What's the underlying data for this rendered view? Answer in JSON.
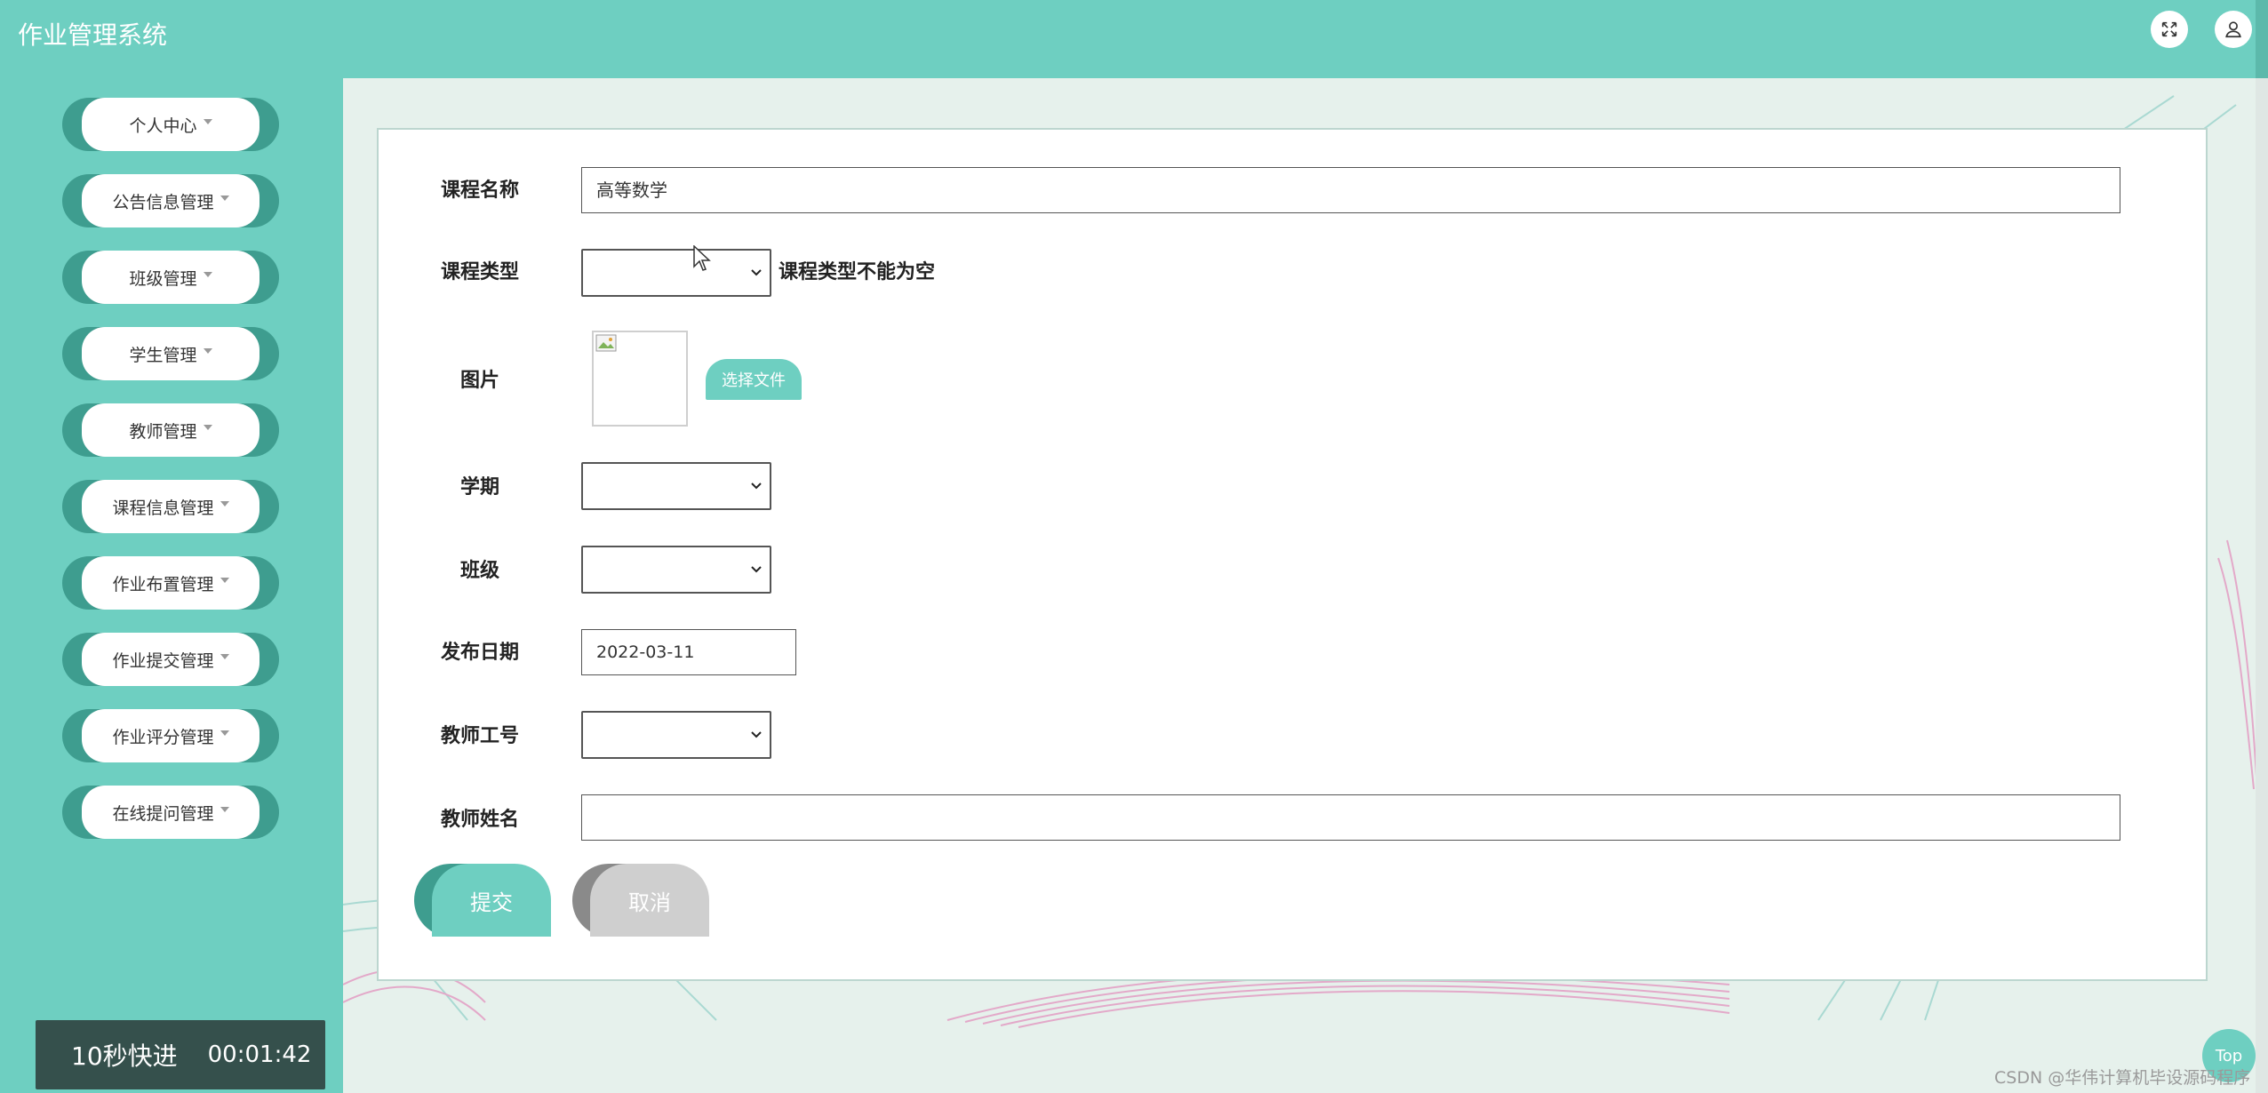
{
  "header": {
    "title": "作业管理系统",
    "fullscreen_icon": "expand-icon",
    "user_icon": "user-icon"
  },
  "sidebar": {
    "items": [
      {
        "label": "个人中心"
      },
      {
        "label": "公告信息管理"
      },
      {
        "label": "班级管理"
      },
      {
        "label": "学生管理"
      },
      {
        "label": "教师管理"
      },
      {
        "label": "课程信息管理"
      },
      {
        "label": "作业布置管理"
      },
      {
        "label": "作业提交管理"
      },
      {
        "label": "作业评分管理"
      },
      {
        "label": "在线提问管理"
      }
    ],
    "fast_forward": {
      "label": "10秒快进",
      "time": "00:01:42"
    }
  },
  "form": {
    "course_name": {
      "label": "课程名称",
      "value": "高等数学"
    },
    "course_type": {
      "label": "课程类型",
      "value": "",
      "error": "课程类型不能为空"
    },
    "image": {
      "label": "图片",
      "button": "选择文件"
    },
    "semester": {
      "label": "学期",
      "value": ""
    },
    "class": {
      "label": "班级",
      "value": ""
    },
    "publish_date": {
      "label": "发布日期",
      "value": "2022-03-11"
    },
    "teacher_id": {
      "label": "教师工号",
      "value": ""
    },
    "teacher_name": {
      "label": "教师姓名",
      "value": ""
    },
    "submit_label": "提交",
    "cancel_label": "取消"
  },
  "top_button": "Top",
  "watermark": "CSDN @华伟计算机毕设源码程序",
  "colors": {
    "primary": "#6ecfc1",
    "primary_dark": "#3e9d8f",
    "fast_forward_bg": "#35504c",
    "main_bg": "#e6f1ec"
  }
}
